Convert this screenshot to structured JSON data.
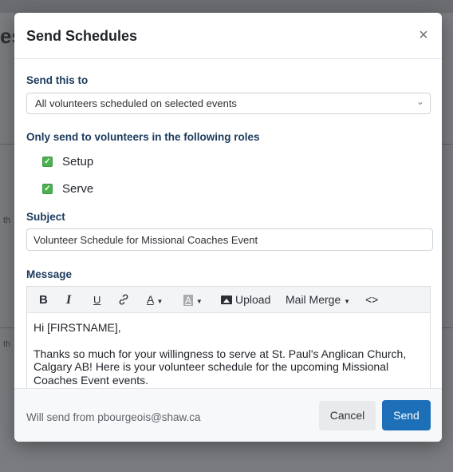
{
  "modal": {
    "title": "Send Schedules",
    "close_symbol": "×"
  },
  "send_to": {
    "label": "Send this to",
    "selected": "All volunteers scheduled on selected events"
  },
  "roles": {
    "label": "Only send to volunteers in the following roles",
    "items": [
      {
        "label": "Setup",
        "checked": true
      },
      {
        "label": "Serve",
        "checked": true
      }
    ]
  },
  "subject": {
    "label": "Subject",
    "value": "Volunteer Schedule for Missional Coaches Event"
  },
  "message": {
    "label": "Message",
    "toolbar": {
      "bold": "B",
      "italic": "I",
      "underline": "U",
      "link_icon": "link-icon",
      "font_color": "A",
      "highlight": "A",
      "upload": "Upload",
      "mail_merge": "Mail Merge",
      "code": "<>"
    },
    "body_greeting": "Hi [FIRSTNAME],",
    "body_text": "Thanks so much for your willingness to serve at St. Paul's Anglican Church, Calgary AB! Here is your volunteer schedule for the upcoming Missional Coaches Event events."
  },
  "footer": {
    "from_text": "Will send from pbourgeois@shaw.ca",
    "cancel": "Cancel",
    "send": "Send"
  },
  "colors": {
    "primary": "#1d6fb8",
    "label": "#1b3a5c",
    "checkbox": "#4caf50"
  }
}
